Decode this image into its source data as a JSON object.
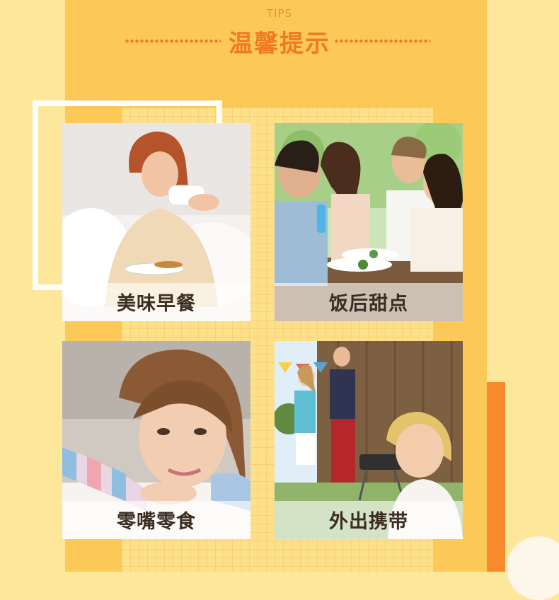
{
  "header": {
    "eyebrow": "TIPS",
    "title": "温馨提示"
  },
  "cards": [
    {
      "label": "美味早餐",
      "photo_subject": "woman-drinking-tea-with-breakfast"
    },
    {
      "label": "饭后甜点",
      "photo_subject": "friends-dining-outdoors"
    },
    {
      "label": "零嘴零食",
      "photo_subject": "girl-resting-on-table"
    },
    {
      "label": "外出携带",
      "photo_subject": "outdoor-barbecue-picnic"
    }
  ],
  "colors": {
    "background": "#fde79a",
    "panel": "#fcc959",
    "accent": "#f07a22",
    "label_text": "#3c2d22"
  }
}
